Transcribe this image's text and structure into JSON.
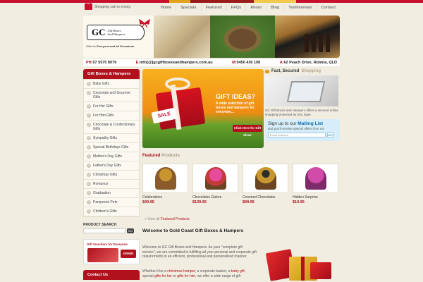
{
  "cart_text": "Shopping cart is empty.",
  "nav": [
    "Home",
    "Specials",
    "Featured",
    "FAQs",
    "About",
    "Blog",
    "Testimonials",
    "Contact"
  ],
  "logo": {
    "initials": "GC",
    "name_line1": "Gift Boxes",
    "name_line2": "And Hampers",
    "tagline_pre": "Gifts for ",
    "tagline_bold": "Everyone and all Occasions"
  },
  "contact_bar": {
    "ph_label": "PH:",
    "ph": "07 5575 8079",
    "email_label": "E:",
    "email": "info[@]gcgiftboxesandhampers.com.au",
    "mobile_label": "M:",
    "mobile": "0450 436 108",
    "address_label": "A:",
    "address": "62 Peach Drive, Robina, QLD"
  },
  "sidebar": {
    "title": "Gift Boxes & Hampers",
    "items": [
      "Baby Gifts",
      "Corporate and Gourmet Gifts",
      "For Her Gifts",
      "For Him Gifts",
      "Chocolate & Confectionary Gifts",
      "Sympathy Gifts",
      "Special Birthdays Gifts",
      "Mother's Day Gifts",
      "Father's Day Gifts",
      "Christmas Gifts",
      "Romance",
      "Graduation",
      "Pampered Pets",
      "Children's Gifts"
    ],
    "search_label": "PRODUCT SEARCH",
    "search_go": "GO",
    "vouchers_title": "Gift Vouchers for Everyone",
    "vouchers_button": "GRAB!",
    "contact_title": "Contact Us"
  },
  "hero": {
    "title": "GIFT IDEAS?",
    "text": "A wide selection of gift boxes and hampers for everyone...",
    "button": "Click Here for Gift Ideas",
    "sale": "SALE"
  },
  "secure": {
    "title_dark": "Fast, Secured",
    "title_light": "Shopping",
    "text": "GC Gift Boxes and Hampers offers a secured online shopping protected by SSL layer."
  },
  "mailing": {
    "title_pre": "Sign up to our",
    "title_bold": "Mailing List",
    "sub": "and you'll receive special offers from us!",
    "placeholder": "Email Address",
    "go": "GO"
  },
  "featured": {
    "title_red": "Featured",
    "title_grey": "Products",
    "view_all_pre": "» View all",
    "view_all_link": "Featured Products",
    "products": [
      {
        "name": "Celebrations",
        "price": "$49.95",
        "color": "#8a5a2b"
      },
      {
        "name": "Chocolates Galore",
        "price": "$139.95",
        "color": "#d23a8a"
      },
      {
        "name": "Crowned Chocolates",
        "price": "$99.95",
        "color": "#6b4423"
      },
      {
        "name": "Hidden Surprise",
        "price": "$19.95",
        "color": "#c63a8f"
      }
    ]
  },
  "welcome": {
    "title": "Welcome to Gold Coast Gift Boxes & Hampers",
    "p1": "Welcome to GC Gift Boxes and Hampers. As your \"complete gift service\", we are committed to fulfilling all your personal and corporate gift requirements in an efficient, professional and personalised manner.",
    "p2_a": "Whether it be a ",
    "p2_link1": "christmas hamper",
    "p2_b": ", a corporate basket, a ",
    "p2_link2": "baby gift",
    "p2_c": ", special ",
    "p2_link3": "gifts for her",
    "p2_d": " or ",
    "p2_link4": "gifts for him",
    "p2_e": ", we offer a wide range of gift"
  },
  "colors": {
    "brand_red": "#b0111d",
    "link_blue": "#0e67a6",
    "background": "#f1ede1"
  }
}
